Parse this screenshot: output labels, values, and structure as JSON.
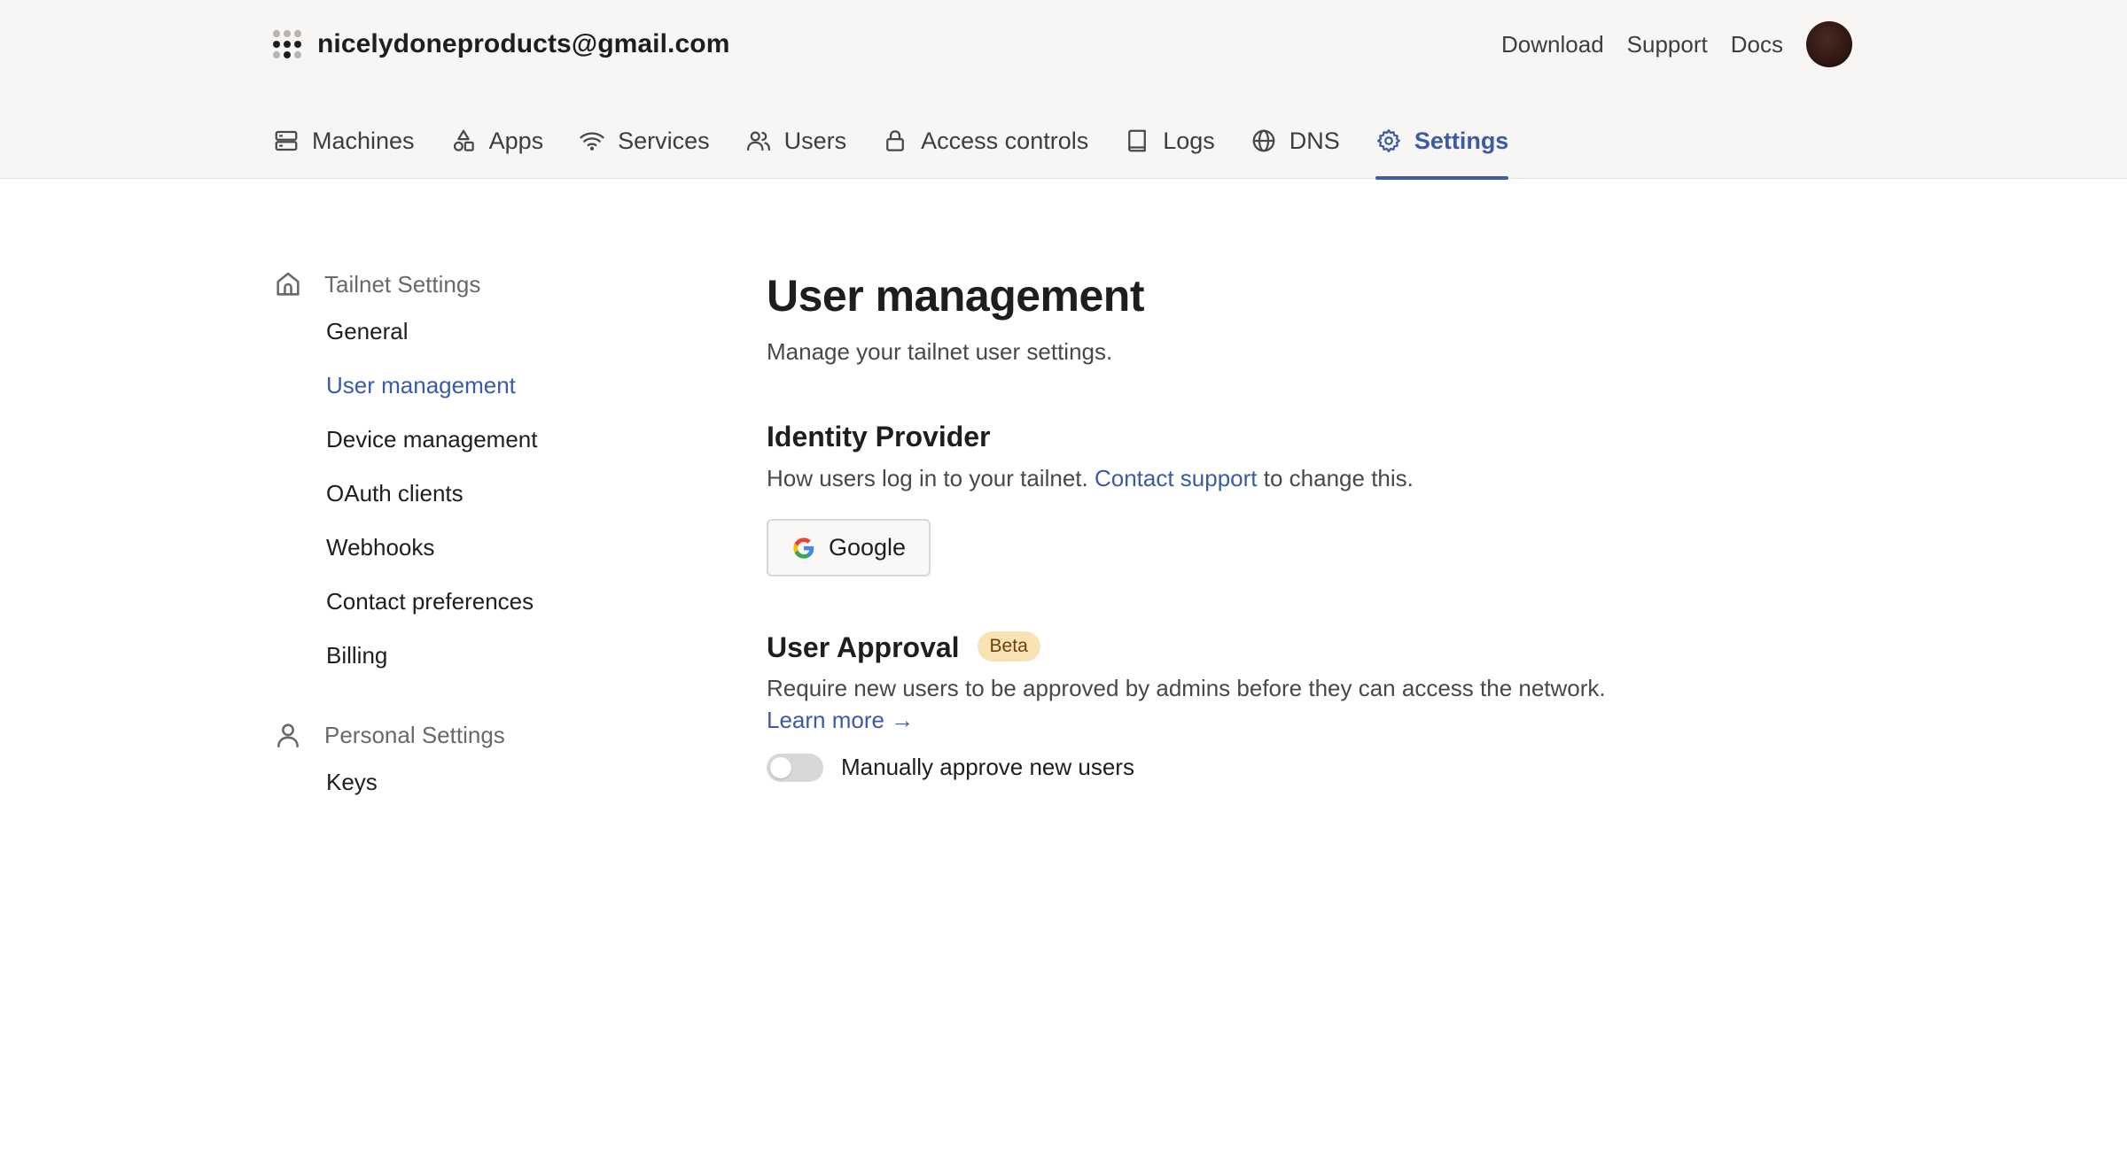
{
  "header": {
    "account_email": "nicelydoneproducts@gmail.com",
    "links": [
      "Download",
      "Support",
      "Docs"
    ]
  },
  "tabs": [
    {
      "label": "Machines",
      "icon": "machines-icon"
    },
    {
      "label": "Apps",
      "icon": "apps-icon"
    },
    {
      "label": "Services",
      "icon": "wifi-icon"
    },
    {
      "label": "Users",
      "icon": "users-icon"
    },
    {
      "label": "Access controls",
      "icon": "lock-icon"
    },
    {
      "label": "Logs",
      "icon": "book-icon"
    },
    {
      "label": "DNS",
      "icon": "globe-icon"
    },
    {
      "label": "Settings",
      "icon": "gear-icon",
      "active": true
    }
  ],
  "sidebar": {
    "tailnet_group": "Tailnet Settings",
    "tailnet_items": [
      "General",
      "User management",
      "Device management",
      "OAuth clients",
      "Webhooks",
      "Contact preferences",
      "Billing"
    ],
    "active_item": "User management",
    "personal_group": "Personal Settings",
    "personal_items": [
      "Keys"
    ]
  },
  "main": {
    "title": "User management",
    "subtitle": "Manage your tailnet user settings.",
    "identity": {
      "title": "Identity Provider",
      "desc_before": "How users log in to your tailnet.",
      "desc_link": "Contact support",
      "desc_after": "to change this.",
      "provider": "Google"
    },
    "approval": {
      "title": "User Approval",
      "badge": "Beta",
      "desc": "Require new users to be approved by admins before they can access the network.",
      "learn_more": "Learn more →",
      "toggle_label": "Manually approve new users",
      "toggle_on": false
    }
  },
  "colors": {
    "accent": "#3b5aa8",
    "header_bg": "#f7f6f5",
    "badge_bg": "#f9e3b4"
  }
}
